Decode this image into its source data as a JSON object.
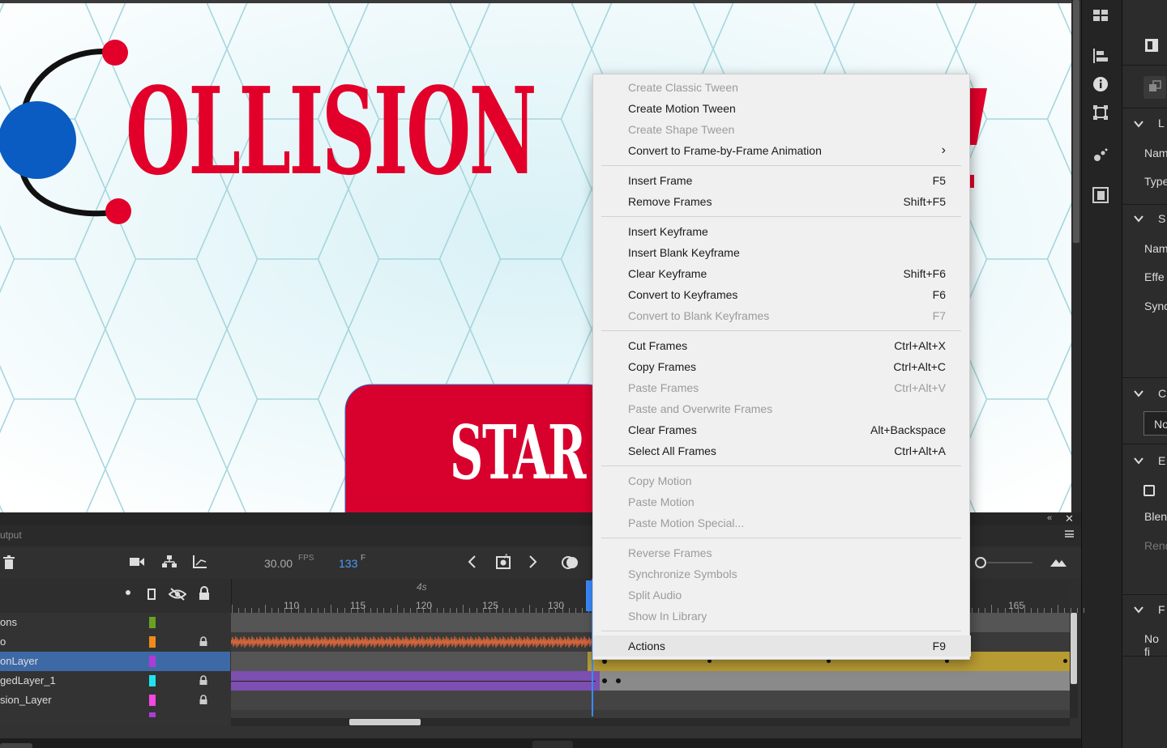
{
  "stage": {
    "title_text": "OLLISION",
    "button_text": "STAR"
  },
  "timeline": {
    "panel_tab": "utput",
    "fps_value": "30.00",
    "fps_unit": "FPS",
    "frame_value": "133",
    "frame_unit": "F",
    "time_marker": "4s",
    "ruler_labels": [
      "110",
      "115",
      "120",
      "125",
      "130",
      "165"
    ],
    "layers": [
      {
        "name": "ons",
        "color": "#6aa121",
        "locked": false
      },
      {
        "name": "o",
        "color": "#f08a1c",
        "locked": true
      },
      {
        "name": "onLayer",
        "color": "#b03ad6",
        "locked": false,
        "selected": true
      },
      {
        "name": "gedLayer_1",
        "color": "#1de5f0",
        "locked": true
      },
      {
        "name": "sion_Layer",
        "color": "#f548e2",
        "locked": true
      }
    ]
  },
  "context_menu": {
    "items": [
      {
        "label": "Create Classic Tween",
        "shortcut": "",
        "disabled": true
      },
      {
        "label": "Create Motion Tween",
        "shortcut": "",
        "disabled": false
      },
      {
        "label": "Create Shape Tween",
        "shortcut": "",
        "disabled": true
      },
      {
        "label": "Convert to Frame-by-Frame Animation",
        "shortcut": "›",
        "disabled": false
      },
      {
        "label": "Insert Frame",
        "shortcut": "F5",
        "disabled": false
      },
      {
        "label": "Remove Frames",
        "shortcut": "Shift+F5",
        "disabled": false
      },
      {
        "label": "Insert Keyframe",
        "shortcut": "",
        "disabled": false
      },
      {
        "label": "Insert Blank Keyframe",
        "shortcut": "",
        "disabled": false
      },
      {
        "label": "Clear Keyframe",
        "shortcut": "Shift+F6",
        "disabled": false
      },
      {
        "label": "Convert to Keyframes",
        "shortcut": "F6",
        "disabled": false
      },
      {
        "label": "Convert to Blank Keyframes",
        "shortcut": "F7",
        "disabled": true
      },
      {
        "label": "Cut Frames",
        "shortcut": "Ctrl+Alt+X",
        "disabled": false
      },
      {
        "label": "Copy Frames",
        "shortcut": "Ctrl+Alt+C",
        "disabled": false
      },
      {
        "label": "Paste Frames",
        "shortcut": "Ctrl+Alt+V",
        "disabled": true
      },
      {
        "label": "Paste and Overwrite Frames",
        "shortcut": "",
        "disabled": true
      },
      {
        "label": "Clear Frames",
        "shortcut": "Alt+Backspace",
        "disabled": false
      },
      {
        "label": "Select All Frames",
        "shortcut": "Ctrl+Alt+A",
        "disabled": false
      },
      {
        "label": "Copy Motion",
        "shortcut": "",
        "disabled": true
      },
      {
        "label": "Paste Motion",
        "shortcut": "",
        "disabled": true
      },
      {
        "label": "Paste Motion Special...",
        "shortcut": "",
        "disabled": true
      },
      {
        "label": "Reverse Frames",
        "shortcut": "",
        "disabled": true
      },
      {
        "label": "Synchronize Symbols",
        "shortcut": "",
        "disabled": true
      },
      {
        "label": "Split Audio",
        "shortcut": "",
        "disabled": true
      },
      {
        "label": "Show In Library",
        "shortcut": "",
        "disabled": true
      },
      {
        "label": "Actions",
        "shortcut": "F9",
        "disabled": false
      }
    ]
  },
  "properties": {
    "labels": [
      "Nam",
      "Type",
      "Nam",
      "Effe",
      "Sync",
      "No",
      "Blen",
      "Rend",
      "No fi"
    ],
    "section_letters": [
      "L",
      "S",
      "C",
      "E",
      "F"
    ]
  },
  "colors": {
    "stage_red": "#e2002a",
    "stage_blue": "#0a5cc2",
    "menu_bg": "#f0f0f0",
    "selection_blue": "#3d6aa6",
    "playhead_blue": "#3a8bff",
    "tween_gold": "#b69a32",
    "tween_purple": "#7c4fb0"
  }
}
